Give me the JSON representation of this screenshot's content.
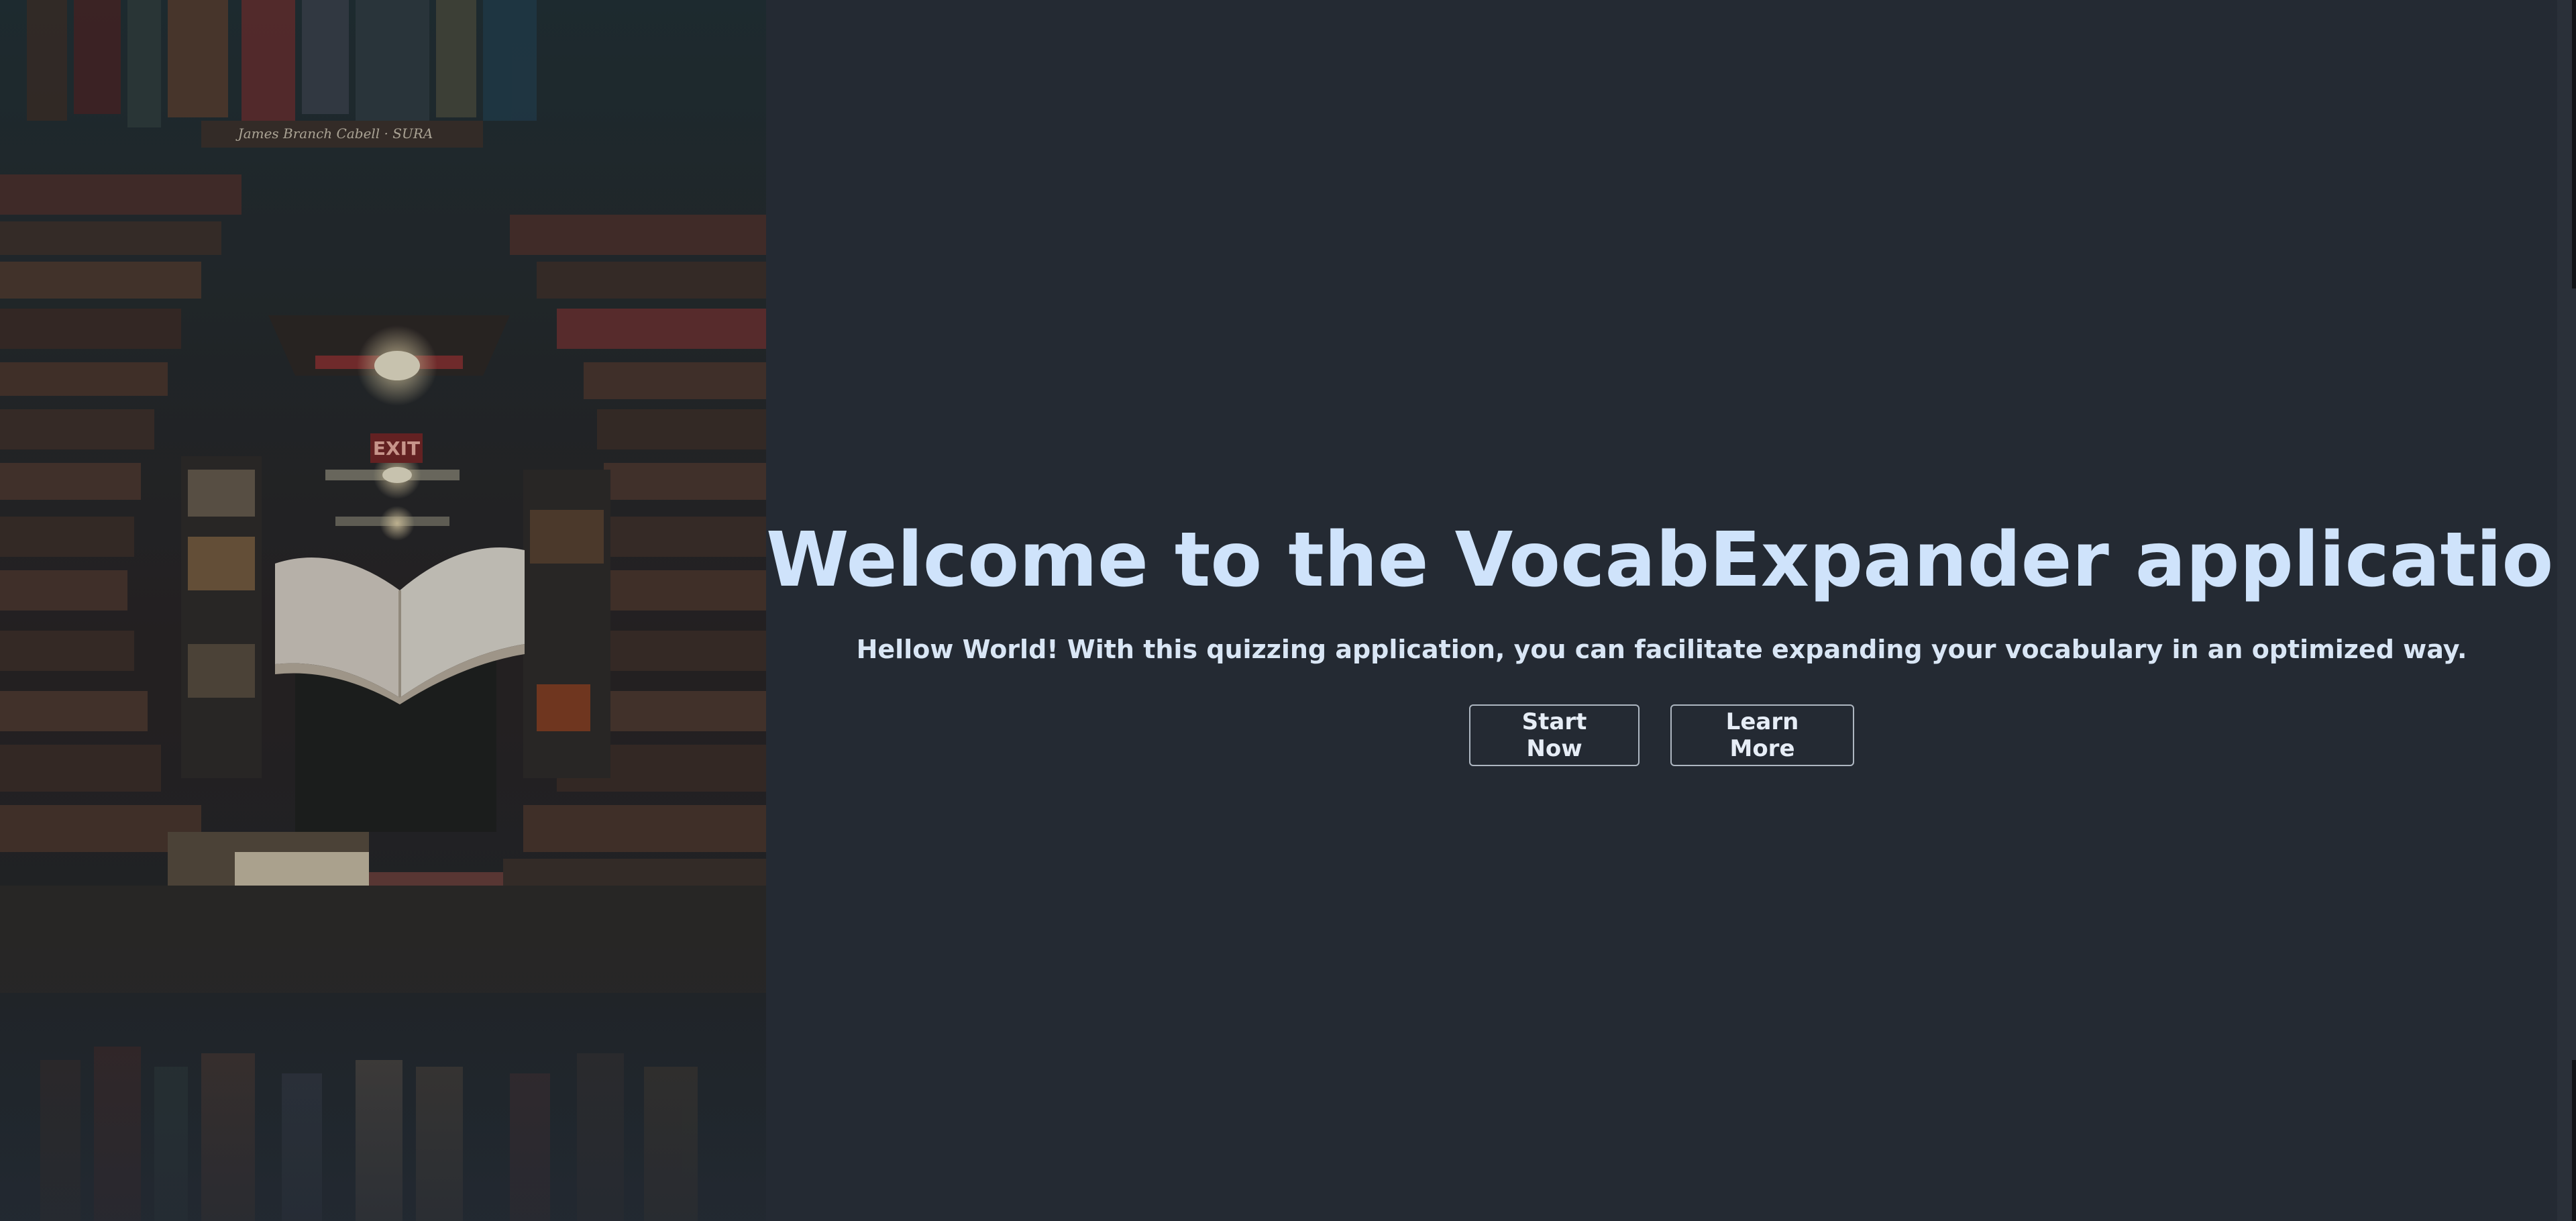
{
  "hero": {
    "title": "Welcome to the VocabExpander application",
    "subtitle": "Hellow World! With this quizzing application, you can facilitate expanding your vocabulary in an optimized way.",
    "buttons": {
      "start_label": "Start Now",
      "learn_label": "Learn More"
    }
  },
  "image": {
    "description_icon": "library-books-photo",
    "book_spine_text": "James Branch Cabell · SURA",
    "exit_sign_text": "EXIT"
  },
  "colors": {
    "background": "#242a33",
    "title": "#cfe3fb",
    "subtitle": "#d9e6f5",
    "button_border": "#aeb7c2",
    "button_text": "#e6edf6"
  }
}
